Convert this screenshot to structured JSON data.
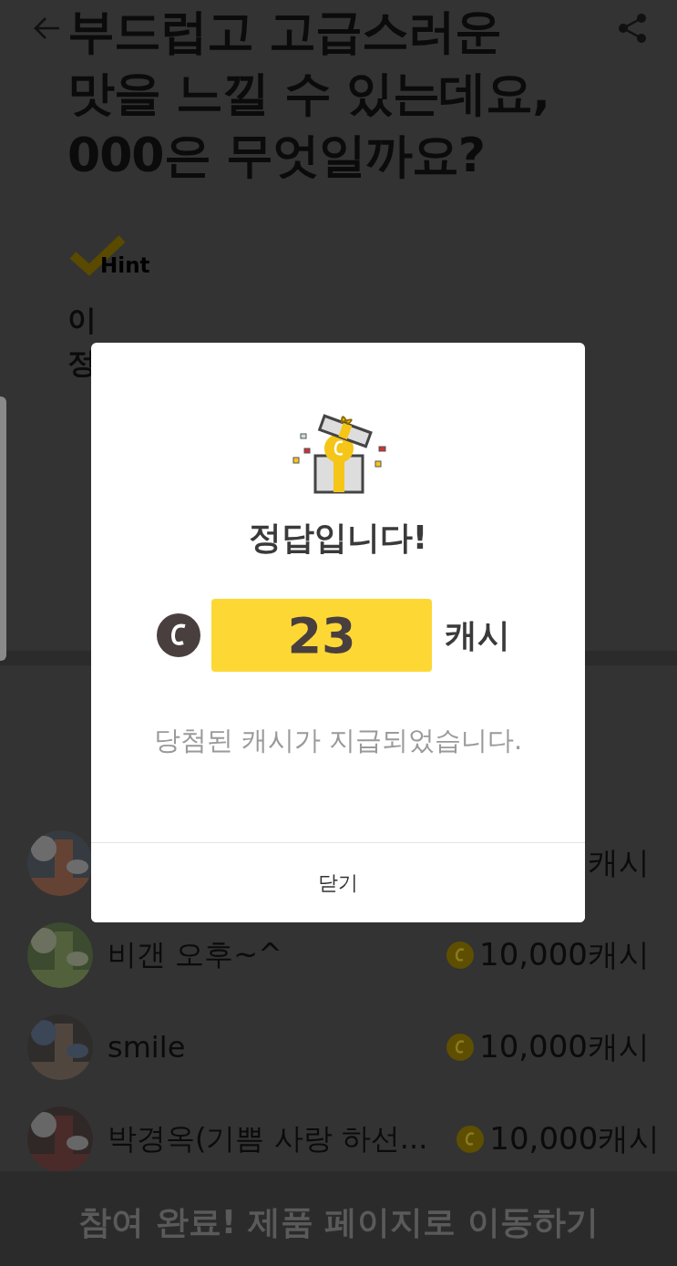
{
  "header": {
    "title_lines": [
      "부드럽고 고급스러운",
      "맛을 느낄 수 있는데요,",
      "000은 무엇일까요?"
    ]
  },
  "hint": {
    "label": "Hint",
    "lines": [
      "이",
      "정"
    ]
  },
  "winners": [
    {
      "amount": "캐시",
      "kind": "picture"
    },
    {
      "name": "비갠 오후~^",
      "amount": "10,000캐시",
      "kind": "picture"
    },
    {
      "name": "smile",
      "amount": "10,000캐시",
      "kind": "picture"
    },
    {
      "name": "박경옥(기쁨 사랑 하선...",
      "amount": "10,000캐시",
      "kind": "picture"
    }
  ],
  "bottom_button": {
    "label": "참여 완료! 제품 페이지로 이동하기",
    "disabled": true
  },
  "modal": {
    "title": "정답입니다!",
    "amount": "23",
    "unit": "캐시",
    "message": "당첨된 캐시가 지급되었습니다.",
    "close": "닫기"
  }
}
